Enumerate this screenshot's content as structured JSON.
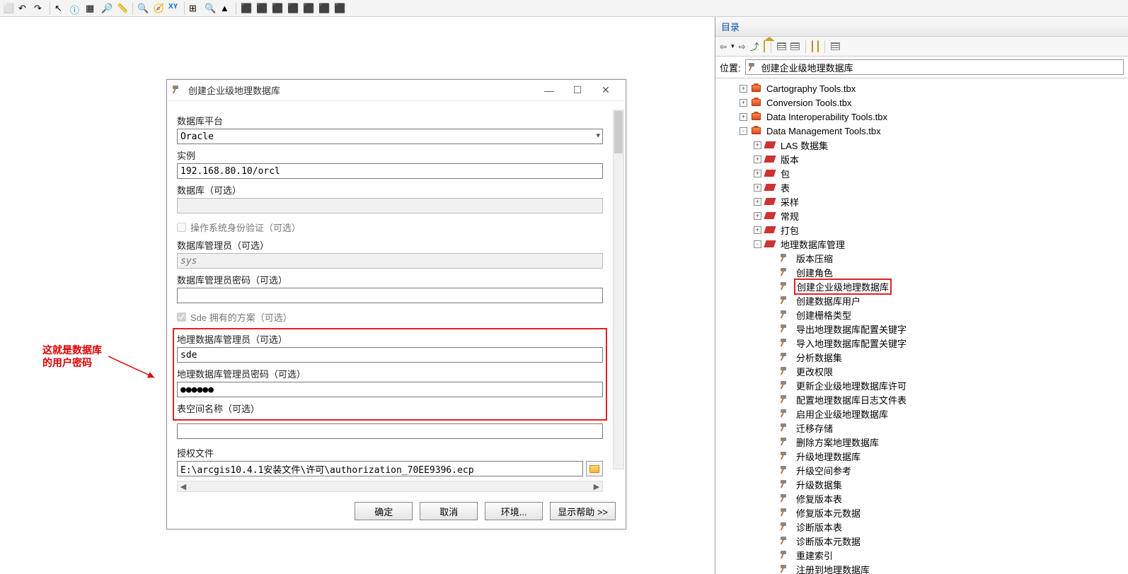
{
  "dialog": {
    "title": "创建企业级地理数据库",
    "fields": {
      "db_platform_label": "数据库平台",
      "db_platform_value": "Oracle",
      "instance_label": "实例",
      "instance_value": "192.168.80.10/orcl",
      "database_label": "数据库（可选）",
      "database_value": "",
      "os_auth_label": "操作系统身份验证（可选）",
      "db_admin_label": "数据库管理员（可选）",
      "db_admin_value": "sys",
      "db_admin_pwd_label": "数据库管理员密码（可选）",
      "db_admin_pwd_value": "",
      "sde_owned_label": "Sde 拥有的方案（可选）",
      "gdb_admin_label": "地理数据库管理员（可选）",
      "gdb_admin_value": "sde",
      "gdb_admin_pwd_label": "地理数据库管理员密码（可选）",
      "gdb_admin_pwd_value": "●●●●●●",
      "tablespace_label": "表空间名称（可选）",
      "tablespace_value": "",
      "auth_file_label": "授权文件",
      "auth_file_value": "E:\\arcgis10.4.1安装文件\\许可\\authorization_70EE9396.ecp"
    },
    "buttons": {
      "ok": "确定",
      "cancel": "取消",
      "env": "环境...",
      "help": "显示帮助 >>"
    }
  },
  "annotation": "这就是数据库的用户密码",
  "catalog": {
    "title": "目录",
    "location_label": "位置:",
    "location_value": "创建企业级地理数据库",
    "toolboxes": [
      {
        "label": "Cartography Tools.tbx",
        "expand": "+"
      },
      {
        "label": "Conversion Tools.tbx",
        "expand": "+"
      },
      {
        "label": "Data Interoperability Tools.tbx",
        "expand": "+"
      },
      {
        "label": "Data Management Tools.tbx",
        "expand": "-"
      }
    ],
    "toolsets": [
      {
        "label": "LAS 数据集",
        "expand": "+"
      },
      {
        "label": "版本",
        "expand": "+"
      },
      {
        "label": "包",
        "expand": "+"
      },
      {
        "label": "表",
        "expand": "+"
      },
      {
        "label": "采样",
        "expand": "+"
      },
      {
        "label": "常规",
        "expand": "+"
      },
      {
        "label": "打包",
        "expand": "+"
      },
      {
        "label": "地理数据库管理",
        "expand": "-"
      }
    ],
    "tools": [
      {
        "label": "版本压缩"
      },
      {
        "label": "创建角色"
      },
      {
        "label": "创建企业级地理数据库",
        "highlight": true
      },
      {
        "label": "创建数据库用户"
      },
      {
        "label": "创建栅格类型"
      },
      {
        "label": "导出地理数据库配置关键字"
      },
      {
        "label": "导入地理数据库配置关键字"
      },
      {
        "label": "分析数据集"
      },
      {
        "label": "更改权限"
      },
      {
        "label": "更新企业级地理数据库许可"
      },
      {
        "label": "配置地理数据库日志文件表"
      },
      {
        "label": "启用企业级地理数据库"
      },
      {
        "label": "迁移存储"
      },
      {
        "label": "删除方案地理数据库"
      },
      {
        "label": "升级地理数据库"
      },
      {
        "label": "升级空间参考"
      },
      {
        "label": "升级数据集"
      },
      {
        "label": "修复版本表"
      },
      {
        "label": "修复版本元数据"
      },
      {
        "label": "诊断版本表"
      },
      {
        "label": "诊断版本元数据"
      },
      {
        "label": "重建索引"
      },
      {
        "label": "注册到地理数据库"
      }
    ]
  }
}
